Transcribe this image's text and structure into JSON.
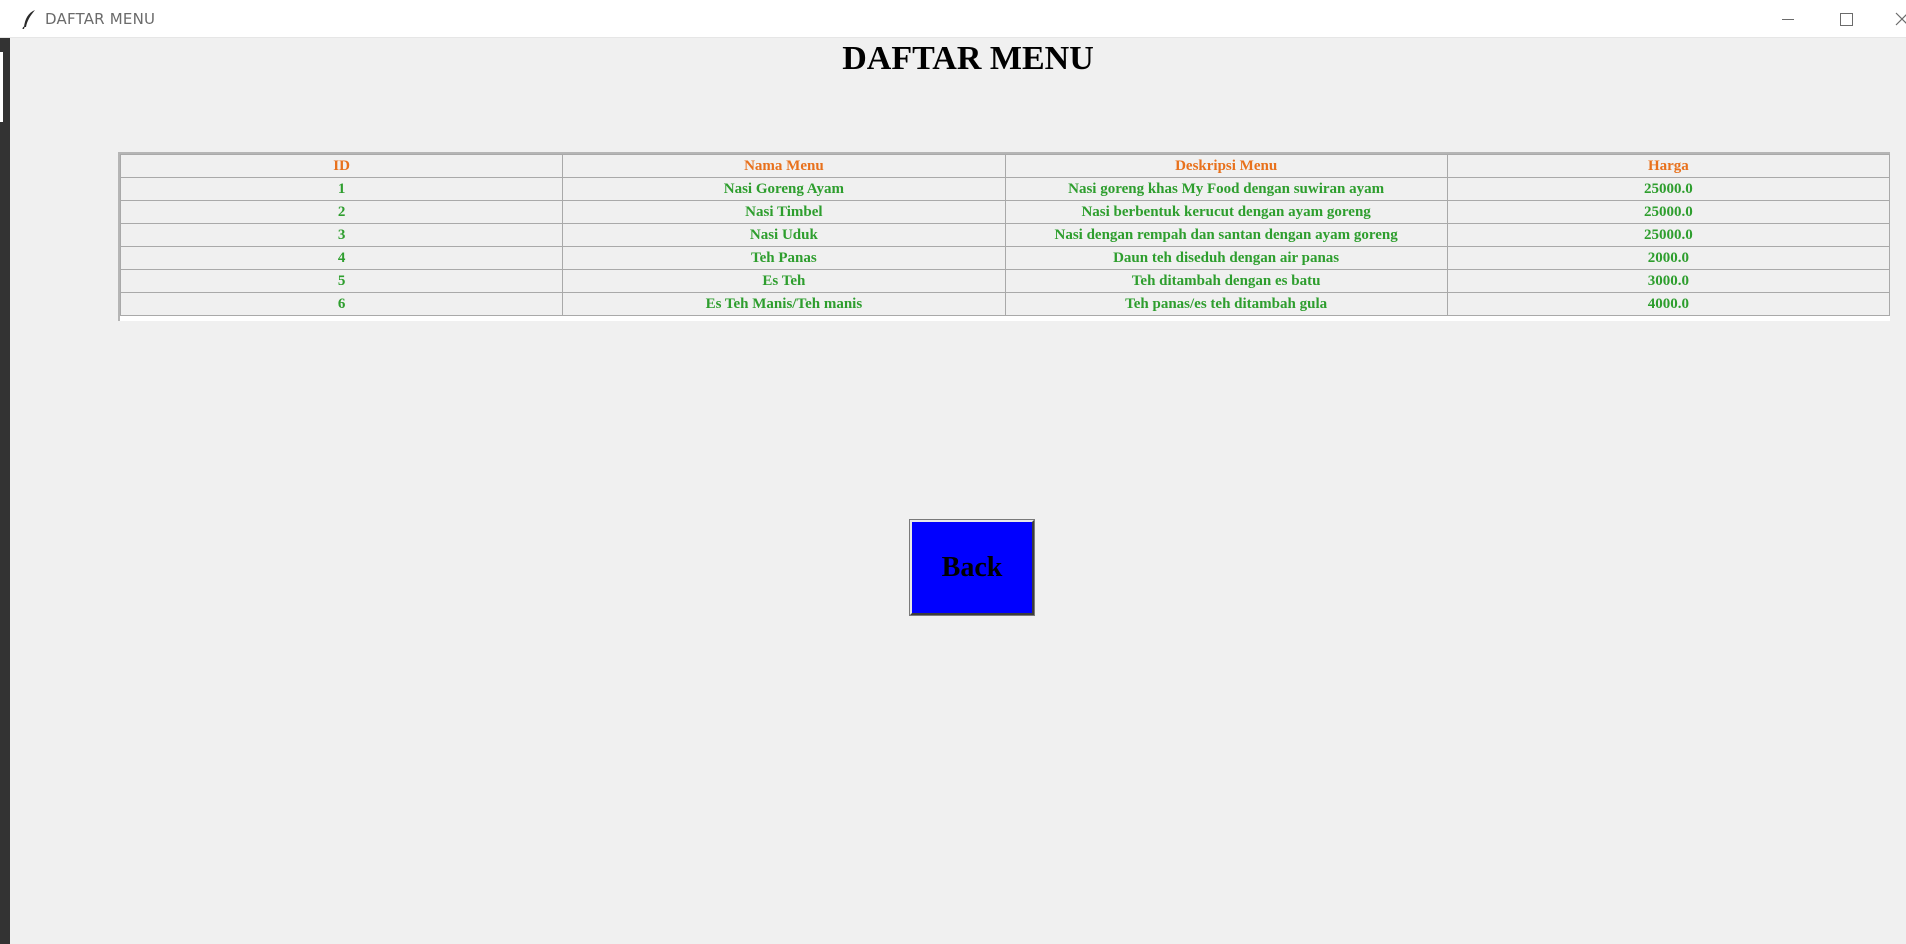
{
  "window": {
    "title": "DAFTAR MENU",
    "icon": "feather-icon",
    "controls": [
      "minimize-icon",
      "maximize-icon",
      "close-icon"
    ]
  },
  "page": {
    "title": "DAFTAR MENU"
  },
  "table": {
    "header_color": "#e8711c",
    "cell_color": "#2e9e2e",
    "columns": [
      "ID",
      "Nama Menu",
      "Deskripsi Menu",
      "Harga"
    ],
    "rows": [
      [
        "1",
        "Nasi Goreng Ayam",
        "Nasi goreng khas My Food dengan suwiran ayam",
        "25000.0"
      ],
      [
        "2",
        "Nasi Timbel",
        "Nasi berbentuk kerucut dengan ayam goreng",
        "25000.0"
      ],
      [
        "3",
        "Nasi Uduk",
        "Nasi dengan rempah dan santan dengan ayam goreng",
        "25000.0"
      ],
      [
        "4",
        "Teh Panas",
        "Daun teh diseduh dengan air panas",
        "2000.0"
      ],
      [
        "5",
        "Es Teh",
        "Teh ditambah dengan es batu",
        "3000.0"
      ],
      [
        "6",
        "Es Teh Manis/Teh manis",
        "Teh panas/es teh ditambah gula",
        "4000.0"
      ]
    ]
  },
  "back_button": {
    "label": "Back",
    "color": "#0000ff"
  }
}
